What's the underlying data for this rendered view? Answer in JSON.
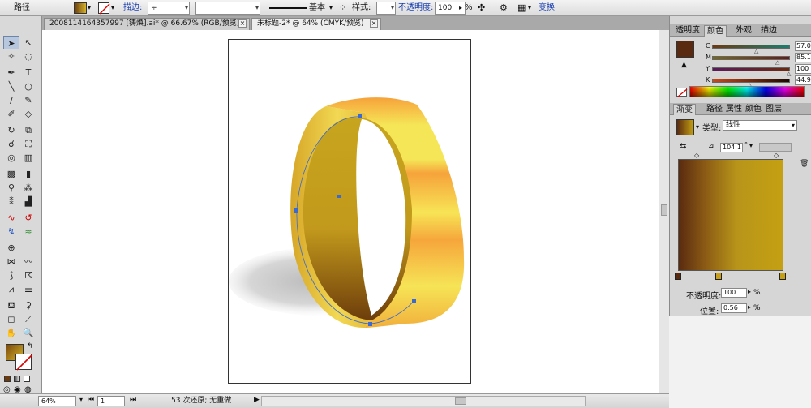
{
  "control": {
    "object_type": "路径",
    "stroke_label": "描边:",
    "brush_label": "基本",
    "style_label": "样式:",
    "opacity_label": "不透明度:",
    "opacity_value": "100",
    "opacity_unit": "%",
    "transform_link": "变换"
  },
  "tabs": [
    {
      "label": "2008114164357997  [铸焕].ai* @ 66.67% (RGB/预览)",
      "close": "×"
    },
    {
      "label": "未标题-2* @ 64% (CMYK/预览)",
      "close": "×"
    }
  ],
  "color_panel": {
    "tabs": [
      "透明度",
      "颜色",
      "外观",
      "描边"
    ],
    "active_tab": "颜色",
    "channels": [
      {
        "key": "C",
        "value": "57.03"
      },
      {
        "key": "M",
        "value": "85.16"
      },
      {
        "key": "Y",
        "value": "100"
      },
      {
        "key": "K",
        "value": "44.92"
      }
    ],
    "fill_color": "#5a2a10"
  },
  "gradient_panel": {
    "tabs": [
      "渐变",
      "路径",
      "属性",
      "颜色",
      "图层"
    ],
    "active_tab": "渐变",
    "type_label": "类型:",
    "type_value": "线性",
    "angle_value": "104.1",
    "angle_unit": "°",
    "stop_color_start": "#5a2a10",
    "stop_color_end": "#c4a012",
    "opacity_label": "不透明度:",
    "opacity_value": "100",
    "opacity_unit": "%",
    "location_label": "位置:",
    "location_value": "0.56",
    "location_unit": "%"
  },
  "status": {
    "zoom": "64%",
    "page": "1",
    "history": "53 次还原; 无重做"
  },
  "colors": {
    "gold_light": "#f5ec52",
    "gold_mid": "#e8c43a",
    "gold_orange": "#f2a33a",
    "gold_dark": "#6e3f0c",
    "inner_gold": "#c6a21d"
  }
}
